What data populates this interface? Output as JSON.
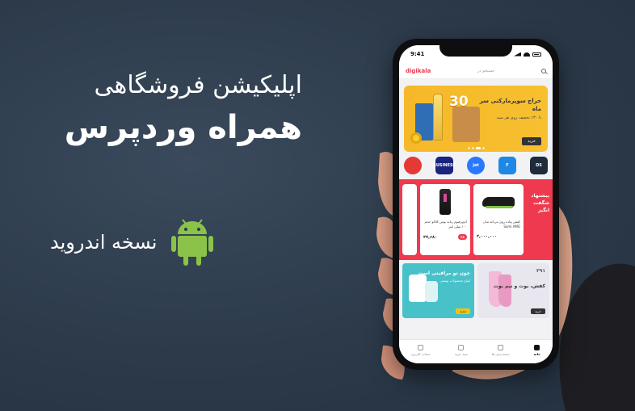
{
  "headline": {
    "line1": "اپلیکیشن فروشگاهی",
    "line2": "همراه وردپرس",
    "android_label": "نسخه  اندروید"
  },
  "colors": {
    "background": "#2c3a4a",
    "accent": "#ef394e",
    "android_green": "#8bc34a",
    "banner_yellow": "#f5b82a"
  },
  "phone": {
    "status_time": "9:41",
    "search": {
      "placeholder": "جستجو در",
      "brand": "digikala"
    },
    "banner": {
      "number": "30",
      "title": "حراج سوپرمارکتی سر ماه",
      "subtitle": "تا ۳۰٪ تخفیف روی هر سبد",
      "button": "خرید"
    },
    "brand_icons": [
      {
        "name": "brand-ds",
        "text": "DS",
        "color": "#1f2a3a"
      },
      {
        "name": "brand-f",
        "text": "F",
        "color": "#1e88e5"
      },
      {
        "name": "brand-jet",
        "text": "jet",
        "color": "#2979ff"
      },
      {
        "name": "brand-business",
        "text": "BUSINESS",
        "color": "#1a237e"
      },
      {
        "name": "brand-red",
        "text": "",
        "color": "#e53935"
      }
    ],
    "amazing": {
      "title": "پیشنهاد شگفت انگیز",
      "products": [
        {
          "name": "کفش پیاده روی مردانه مدل Sumi AMG",
          "price": "۲,۰۰۰,۰۰۰",
          "discount": ""
        },
        {
          "name": "ادوپرفیوم زنانه بوس کلاکو حجم ۱۰۰ میلی لیتر",
          "price": "۳۷,۶۸۰",
          "discount": "۳۸"
        }
      ]
    },
    "promos": [
      {
        "number": "۳۹۱",
        "title": "کفش، بوت و نیم بوت",
        "button": "خرید"
      },
      {
        "title": "چون تو مراقبتی است",
        "subtitle": "انواع محصولات پوستی",
        "button": "جدید"
      }
    ],
    "nav": [
      {
        "label": "خانه",
        "active": true
      },
      {
        "label": "دسته بندی ها",
        "active": false
      },
      {
        "label": "سبد خرید",
        "active": false
      },
      {
        "label": "حساب کاربری",
        "active": false
      }
    ]
  }
}
